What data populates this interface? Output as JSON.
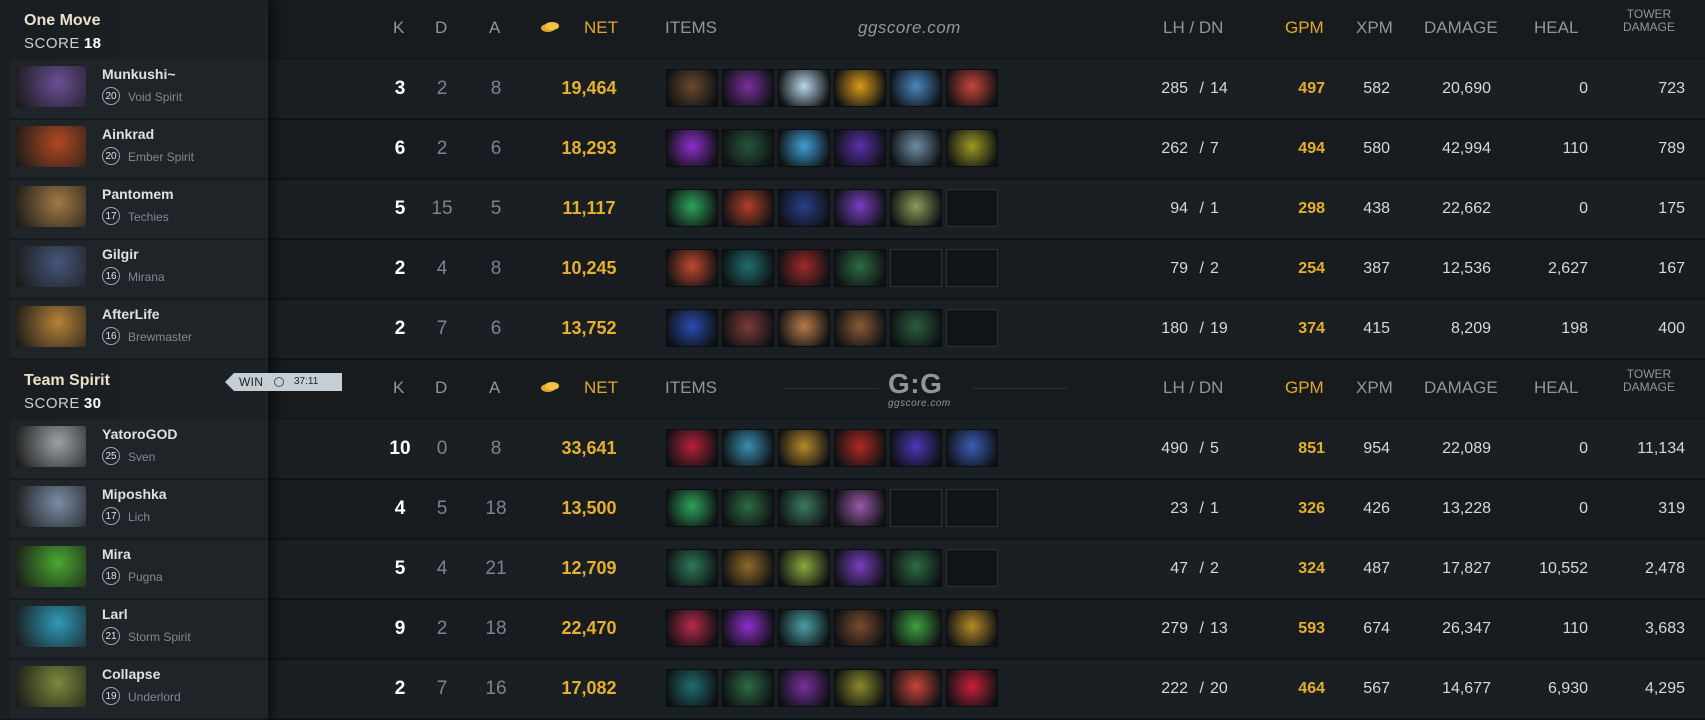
{
  "headers": {
    "k": "K",
    "d": "D",
    "a": "A",
    "net": "NET",
    "items": "ITEMS",
    "lh_dn": "LH  /  DN",
    "gpm": "GPM",
    "xpm": "XPM",
    "damage": "DAMAGE",
    "heal": "HEAL",
    "tower_line1": "TOWER",
    "tower_line2": "DAMAGE"
  },
  "watermark_top": "ggscore.com",
  "watermark_mid": "G:G",
  "watermark_mid_sub": "ggscore.com",
  "win_badge": {
    "label": "WIN",
    "time": "37:11"
  },
  "teams": [
    {
      "name": "One Move",
      "score_label": "SCORE",
      "score": "18",
      "players": [
        {
          "name": "Munkushi~",
          "level": "20",
          "hero": "Void Spirit",
          "k": "3",
          "d": "2",
          "a": "8",
          "net": "19,464",
          "lh": "285",
          "dn": "14",
          "gpm": "497",
          "xpm": "582",
          "damage": "20,690",
          "heal": "0",
          "tower": "723",
          "portrait": "#6a4f96",
          "items": [
            "#6b4a2e",
            "#7a2f9e",
            "#b8d6e8",
            "#d89a1c",
            "#4a87c0",
            "#c8453a"
          ]
        },
        {
          "name": "Ainkrad",
          "level": "20",
          "hero": "Ember Spirit",
          "k": "6",
          "d": "2",
          "a": "6",
          "net": "18,293",
          "lh": "262",
          "dn": "7",
          "gpm": "494",
          "xpm": "580",
          "damage": "42,994",
          "heal": "110",
          "tower": "789",
          "portrait": "#b04a22",
          "items": [
            "#8e2fc9",
            "#27553a",
            "#3f9fd6",
            "#5a2fa8",
            "#6d8fa3",
            "#9c9a24"
          ]
        },
        {
          "name": "Pantomem",
          "level": "17",
          "hero": "Techies",
          "k": "5",
          "d": "15",
          "a": "5",
          "net": "11,117",
          "lh": "94",
          "dn": "1",
          "gpm": "298",
          "xpm": "438",
          "damage": "22,662",
          "heal": "0",
          "tower": "175",
          "portrait": "#a27a44",
          "items": [
            "#2ea25a",
            "#b0402a",
            "#2a3f8c",
            "#7a3ec2",
            "#8d9a5a",
            "empty"
          ]
        },
        {
          "name": "Gilgir",
          "level": "16",
          "hero": "Mirana",
          "k": "2",
          "d": "4",
          "a": "8",
          "net": "10,245",
          "lh": "79",
          "dn": "2",
          "gpm": "254",
          "xpm": "387",
          "damage": "12,536",
          "heal": "2,627",
          "tower": "167",
          "portrait": "#46577a",
          "items": [
            "#c2492f",
            "#1f6e6e",
            "#a12a2a",
            "#2d6b44",
            "empty",
            "empty"
          ]
        },
        {
          "name": "AfterLife",
          "level": "16",
          "hero": "Brewmaster",
          "k": "2",
          "d": "7",
          "a": "6",
          "net": "13,752",
          "lh": "180",
          "dn": "19",
          "gpm": "374",
          "xpm": "415",
          "damage": "8,209",
          "heal": "198",
          "tower": "400",
          "portrait": "#b58238",
          "items": [
            "#2a4bb0",
            "#7e3a3a",
            "#b97b4a",
            "#8a5a36",
            "#2b5e3d",
            "empty"
          ]
        }
      ]
    },
    {
      "name": "Team Spirit",
      "score_label": "SCORE",
      "score": "30",
      "players": [
        {
          "name": "YatoroGOD",
          "level": "25",
          "hero": "Sven",
          "k": "10",
          "d": "0",
          "a": "8",
          "net": "33,641",
          "lh": "490",
          "dn": "5",
          "gpm": "851",
          "xpm": "954",
          "damage": "22,089",
          "heal": "0",
          "tower": "11,134",
          "portrait": "#9aa2a6",
          "items": [
            "#b8203a",
            "#3a8fb0",
            "#b68a2a",
            "#b02a24",
            "#4b38b8",
            "#3a5fb8"
          ]
        },
        {
          "name": "Miposhka",
          "level": "17",
          "hero": "Lich",
          "k": "4",
          "d": "5",
          "a": "18",
          "net": "13,500",
          "lh": "23",
          "dn": "1",
          "gpm": "326",
          "xpm": "426",
          "damage": "13,228",
          "heal": "0",
          "tower": "319",
          "portrait": "#7a8ea6",
          "items": [
            "#2ea25a",
            "#2d6b44",
            "#3b7a5e",
            "#9a5aa8",
            "empty",
            "empty"
          ]
        },
        {
          "name": "Mira",
          "level": "18",
          "hero": "Pugna",
          "k": "5",
          "d": "4",
          "a": "21",
          "net": "12,709",
          "lh": "47",
          "dn": "2",
          "gpm": "324",
          "xpm": "487",
          "damage": "17,827",
          "heal": "10,552",
          "tower": "2,478",
          "portrait": "#4aa830",
          "items": [
            "#2e7a5a",
            "#8e6a2a",
            "#8aa83a",
            "#7a3ec2",
            "#2d6b44",
            "empty"
          ]
        },
        {
          "name": "Larl",
          "level": "21",
          "hero": "Storm Spirit",
          "k": "9",
          "d": "2",
          "a": "18",
          "net": "22,470",
          "lh": "279",
          "dn": "13",
          "gpm": "593",
          "xpm": "674",
          "damage": "26,347",
          "heal": "110",
          "tower": "3,683",
          "portrait": "#2f9ab8",
          "items": [
            "#b82a4a",
            "#8e2fc9",
            "#4aa0a8",
            "#7a4a2e",
            "#3ea040",
            "#b68a2a"
          ]
        },
        {
          "name": "Collapse",
          "level": "19",
          "hero": "Underlord",
          "k": "2",
          "d": "7",
          "a": "16",
          "net": "17,082",
          "lh": "222",
          "dn": "20",
          "gpm": "464",
          "xpm": "567",
          "damage": "14,677",
          "heal": "6,930",
          "tower": "4,295",
          "portrait": "#7a8a3a",
          "items": [
            "#1f6e6e",
            "#2d6b44",
            "#7a2f9e",
            "#8a8a2a",
            "#c8453a",
            "#c8203a"
          ]
        }
      ]
    }
  ]
}
